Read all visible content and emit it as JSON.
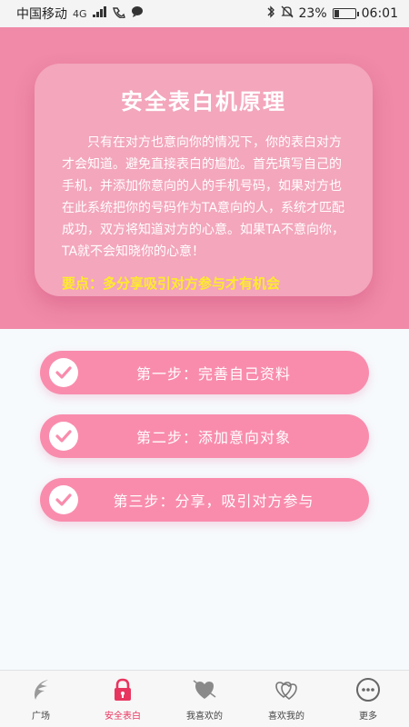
{
  "status_bar": {
    "carrier": "中国移动",
    "network": "4G",
    "battery_percent": "23%",
    "battery_level": 0.23,
    "time": "06:01",
    "icons": [
      "signal-icon",
      "call-icon",
      "chat-icon",
      "bluetooth-icon",
      "mute-bell-icon",
      "battery-icon"
    ]
  },
  "hero": {
    "title": "安全表白机原理",
    "description": "只有在对方也意向你的情况下，你的表白对方才会知道。避免直接表白的尴尬。首先填写自己的手机，并添加你意向的人的手机号码，如果对方也在此系统把你的号码作为TA意向的人，系统才匹配成功，双方将知道对方的心意。如果TA不意向你，TA就不会知晓你的心意！",
    "highlight": "要点：多分享吸引对方参与才有机会",
    "bg_color": "#f08aa8",
    "highlight_color": "#ffeb2a"
  },
  "steps": [
    {
      "label": "第一步：完善自己资料",
      "icon": "check-icon"
    },
    {
      "label": "第二步：添加意向对象",
      "icon": "check-icon"
    },
    {
      "label": "第三步：分享，吸引对方参与",
      "icon": "check-icon"
    }
  ],
  "tabbar": {
    "active_index": 1,
    "accent_color": "#e8355f",
    "items": [
      {
        "label": "广场",
        "icon": "wing-icon"
      },
      {
        "label": "安全表白",
        "icon": "lock-icon"
      },
      {
        "label": "我喜欢的",
        "icon": "heart-arrow-icon"
      },
      {
        "label": "喜欢我的",
        "icon": "double-heart-icon"
      },
      {
        "label": "更多",
        "icon": "more-icon"
      }
    ]
  }
}
